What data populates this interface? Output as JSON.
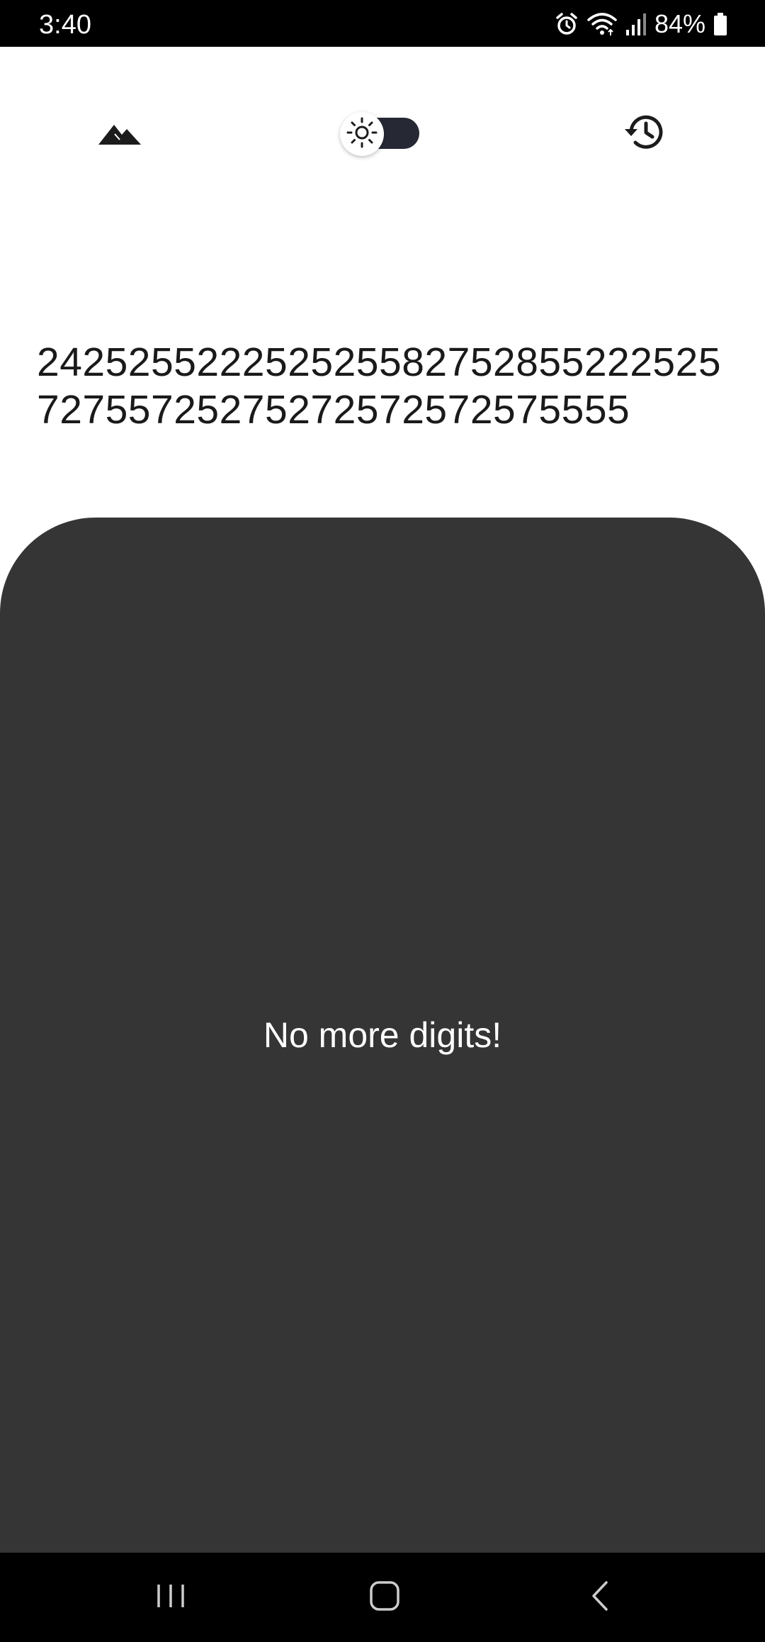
{
  "status_bar": {
    "time": "3:40",
    "battery": "84%",
    "icons": [
      "alarm-icon",
      "wifi-icon",
      "signal-icon",
      "battery-icon"
    ]
  },
  "top_bar": {
    "icons": [
      "mountain-icon",
      "sun-icon",
      "history-icon"
    ],
    "theme_mode": "light",
    "toggle_track_color": "#262833"
  },
  "display": {
    "digits": "24252552225252558275285522252572755725275272572572575555"
  },
  "panel": {
    "message": "No more digits!",
    "background": "#353535"
  },
  "nav_bar": {
    "icons": [
      "recents-icon",
      "home-icon",
      "back-icon"
    ]
  }
}
